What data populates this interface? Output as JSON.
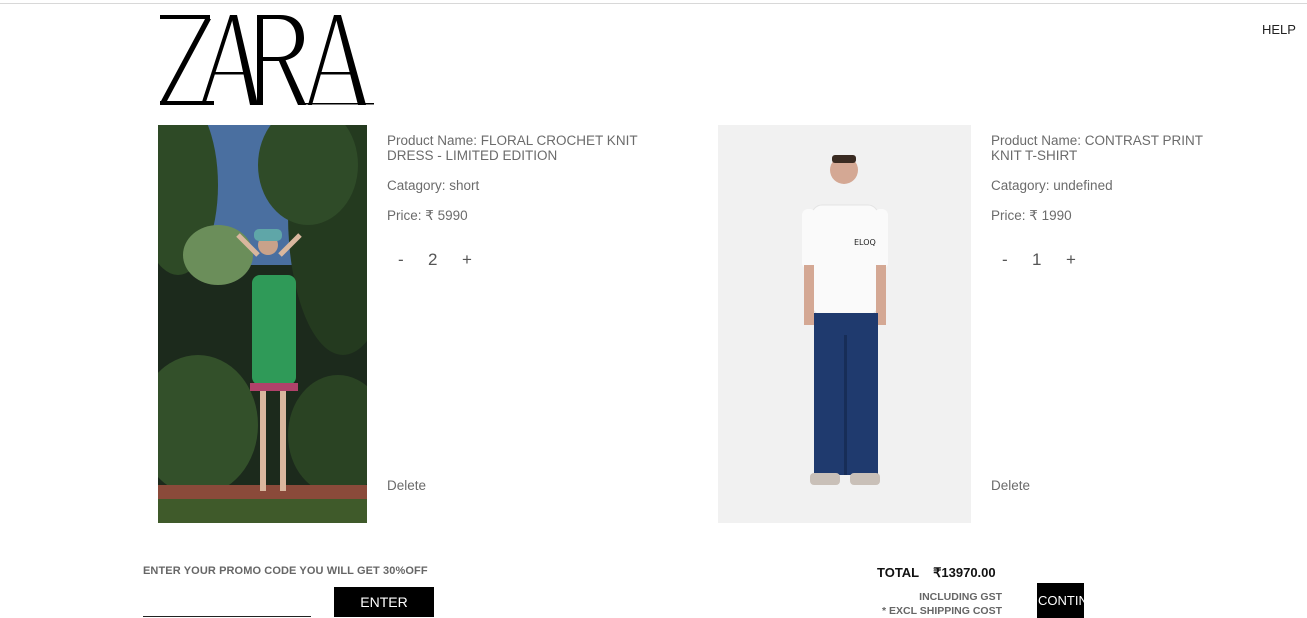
{
  "header": {
    "brand": "ZARA",
    "help_label": "HELP"
  },
  "cart": {
    "items": [
      {
        "name_line": "Product Name: FLORAL CROCHET KNIT DRESS - LIMITED EDITION",
        "category_line": "Catagory: short",
        "price_line": "Price: ₹ 5990",
        "quantity": "2",
        "decrement_label": "-",
        "increment_label": "+",
        "delete_label": "Delete"
      },
      {
        "name_line": "Product Name: CONTRAST PRINT KNIT T-SHIRT",
        "category_line": "Catagory: undefined",
        "price_line": "Price: ₹ 1990",
        "quantity": "1",
        "decrement_label": "-",
        "increment_label": "+",
        "delete_label": "Delete"
      }
    ]
  },
  "promo": {
    "label": "ENTER YOUR PROMO CODE YOU WILL GET 30%OFF",
    "input_value": "",
    "enter_label": "ENTER"
  },
  "summary": {
    "total_label": "TOTAL",
    "total_value": "₹13970.00",
    "gst_note": "INCLUDING GST",
    "shipping_note": "* EXCL SHIPPING COST",
    "continue_label": "CONTINUE"
  },
  "colors": {
    "text": "#6b6b6b",
    "button_bg": "#000000",
    "button_text": "#ffffff"
  }
}
